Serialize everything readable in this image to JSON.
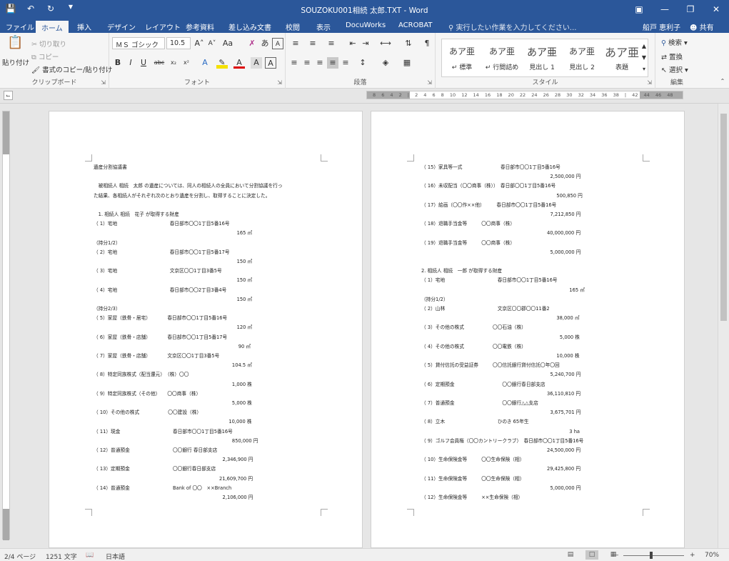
{
  "window": {
    "title": "SOUZOKU001相続 太郎.TXT - Word"
  },
  "tabs": [
    "ファイル",
    "ホーム",
    "挿入",
    "デザイン",
    "レイアウト",
    "参考資料",
    "差し込み文書",
    "校閲",
    "表示",
    "DocuWorks",
    "ACROBAT"
  ],
  "tell_me": "実行したい作業を入力してください...",
  "user": "船戸 恵利子",
  "share": "共有",
  "clipboard": {
    "paste": "貼り付け",
    "cut": "切り取り",
    "copy": "コピー",
    "format_painter": "書式のコピー/貼り付け",
    "label": "クリップボード"
  },
  "font": {
    "name": "ＭＳ ゴシック",
    "size": "10.5",
    "label": "フォント"
  },
  "paragraph": {
    "label": "段落"
  },
  "styles": {
    "label": "スタイル",
    "items": [
      {
        "preview": "あア亜",
        "name": "↵ 標準"
      },
      {
        "preview": "あア亜",
        "name": "↵ 行間詰め"
      },
      {
        "preview": "あア亜",
        "name": "見出し 1"
      },
      {
        "preview": "あア亜",
        "name": "見出し 2"
      },
      {
        "preview": "あア亜",
        "name": "表題"
      }
    ]
  },
  "editing": {
    "find": "検索",
    "replace": "置換",
    "select": "選択",
    "label": "編集"
  },
  "ruler": {
    "numbers": "8 6 4 2 | 2 4 6 8 10 12 14 16 18 20 22 24 26 28 30 32 34 36 38 | 42 44 46 48"
  },
  "page1": [
    "遺産分割協議書",
    "",
    "　被相続人 相続　太郎 の遺産については、同人の相続人の全員において分割協議を行っ",
    "た結果、各相続人がそれぞれ次のとおり遺産を分割し、取得することに決定した。",
    "",
    "　1. 相続人 相続　花子 が取得する財産",
    "（ 1）宅地　　　　　　　　　　　春日部市〇〇1丁目5番16号",
    "　　　　　　　　　　　　　　　　　　　　　　　　　　　　　　165 ㎡",
    "（持分1/2）",
    "（ 2）宅地　　　　　　　　　　　春日部市〇〇1丁目5番17号",
    "　　　　　　　　　　　　　　　　　　　　　　　　　　　　　　150 ㎡",
    "（ 3）宅地　　　　　　　　　　　文京区〇〇1丁目3番5号",
    "　　　　　　　　　　　　　　　　　　　　　　　　　　　　　　150 ㎡",
    "（ 4）宅地　　　　　　　　　　　春日部市〇〇2丁目3番4号",
    "　　　　　　　　　　　　　　　　　　　　　　　　　　　　　　150 ㎡",
    "（持分2/3）",
    "（ 5）家屋（鉄骨・居宅）　　　　春日部市〇〇1丁目5番16号",
    "　　　　　　　　　　　　　　　　　　　　　　　　　　　　　　120 ㎡",
    "（ 6）家屋（鉄骨・店舗）　　　　春日部市〇〇1丁目5番17号",
    "　　　　　　　　　　　　　　　　　　　　　　　　　　　　　　 90 ㎡",
    "（ 7）家屋（鉄骨・店舗）　　　　文京区〇〇1丁目3番5号",
    "　　　　　　　　　　　　　　　　　　　　　　　　　　　　　104.5 ㎡",
    "（ 8）特定同族株式（配当還元）　（株）〇〇",
    "　　　　　　　　　　　　　　　　　　　　　　　　　　　　　1,000 株",
    "（ 9）特定同族株式（その他）　　〇〇商事（株）",
    "　　　　　　　　　　　　　　　　　　　　　　　　　　　　　5,000 株",
    "（ 10）その他の株式　　　　　　〇〇建設（株）",
    "　　　　　　　　　　　　　　　　　　　　　　　　　　　　 10,000 株",
    "（ 11）現金　　　　　　　　　　　春日部市〇〇1丁目5番16号",
    "　　　　　　　　　　　　　　　　　　　　　　　　　　　　　850,000 円",
    "（ 12）普通預金　　　　　　　　　〇〇銀行 春日部支店",
    "　　　　　　　　　　　　　　　　　　　　　　　　　　　2,346,900 円",
    "（ 13）定期預金　　　　　　　　　〇〇銀行春日部支店",
    "　　　　　　　　　　　　　　　　　　　　　　　　　　 21,609,700 円",
    "（ 14）普通預金　　　　　　　　　Bank of 〇〇　××Branch",
    "　　　　　　　　　　　　　　　　　　　　　　　　　　　2,106,000 円"
  ],
  "page2": [
    "（ 15）家具等一式　　　　　　　　春日部市〇〇1丁目5番16号",
    "　　　　　　　　　　　　　　　　　　　　　　　　　　　2,500,000 円",
    "（ 16）未収配当（〇〇商事（株））　春日部〇〇1丁目5番16号",
    "　　　　　　　　　　　　　　　　　　　　　　　　　　　　 500,850 円",
    "（ 17）絵画（〇〇作××他）　　　春日部市〇〇1丁目5番16号",
    "　　　　　　　　　　　　　　　　　　　　　　　　　　　7,212,850 円",
    "（ 18）退職手当金等　　　〇〇商事（株）",
    "　　　　　　　　　　　　　　　　　　　　　　　　　　 40,000,000 円",
    "（ 19）退職手当金等　　　〇〇商事（株）",
    "　　　　　　　　　　　　　　　　　　　　　　　　　　　5,000,000 円",
    "",
    "2. 相続人 相続　一郎 が取得する財産",
    "（ 1）宅地　　　　　　　　　　　春日部市〇〇1丁目5番16号",
    "　　　　　　　　　　　　　　　　　　　　　　　　　　　　　　　165 ㎡",
    "（持分1/2）",
    "（ 2）山林　　　　　　　　　　　文京区〇〇郡〇〇11番2",
    "　　　　　　　　　　　　　　　　　　　　　　　　　　　　 38,000 ㎡",
    "（ 3）その他の株式　　　　　　〇〇石油（株）",
    "　　　　　　　　　　　　　　　　　　　　　　　　　　　　　5,000 株",
    "（ 4）その他の株式　　　　　　〇〇電鉄（株）",
    "　　　　　　　　　　　　　　　　　　　　　　　　　　　　 10,000 株",
    "（ 5）貸付信託の受益証券　　　〇〇信託銀行貸付信託〇年〇回",
    "　　　　　　　　　　　　　　　　　　　　　　　　　　　5,240,700 円",
    "（ 6）定期預金　　　　　　　　　　〇〇銀行春日部支店",
    "　　　　　　　　　　　　　　　　　　　　　　　　　　 36,110,810 円",
    "（ 7）普通預金　　　　　　　　　　〇〇銀行△△支店",
    "　　　　　　　　　　　　　　　　　　　　　　　　　　　3,675,701 円",
    "（ 8）立木　　　　　　　　　　　ひのき 65年生",
    "　　　　　　　　　　　　　　　　　　　　　　　　　　　　　　　3 ha",
    "（ 9）ゴルフ会員権（〇〇カントリークラブ）　春日部市〇〇1丁目5番16号",
    "　　　　　　　　　　　　　　　　　　　　　　　　　　 24,500,000 円",
    "（ 10）生命保険金等　　　〇〇生命保険（相）",
    "　　　　　　　　　　　　　　　　　　　　　　　　　　 29,425,800 円",
    "（ 11）生命保険金等　　　〇〇生命保険（相）",
    "　　　　　　　　　　　　　　　　　　　　　　　　　　　5,000,000 円",
    "（ 12）生命保険金等　　　××生命保険（相）"
  ],
  "status": {
    "page": "2/4 ページ",
    "words": "1251 文字",
    "lang": "日本語",
    "zoom": "70%"
  }
}
